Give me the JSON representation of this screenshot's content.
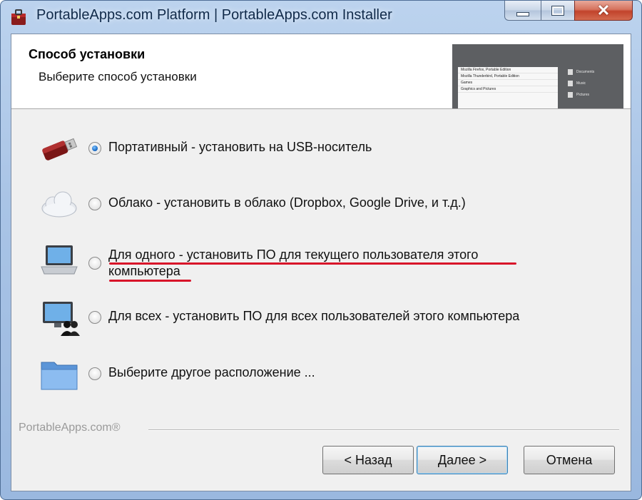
{
  "window": {
    "title": "PortableApps.com Platform | PortableApps.com Installer",
    "controls": {
      "minimize_icon": "minimize-icon",
      "maximize_icon": "maximize-icon",
      "close_icon": "close-icon"
    }
  },
  "header": {
    "title": "Способ установки",
    "subtitle": "Выберите способ установки",
    "preview": {
      "menu_items": [
        "Mozilla Firefox, Portable Edition",
        "Mozilla Thunderbird, Portable Edition",
        "Games",
        "Graphics and Pictures"
      ],
      "side_items": [
        "Documents",
        "Music",
        "Pictures"
      ]
    }
  },
  "options": [
    {
      "icon": "usb-drive-icon",
      "label": "Портативный - установить на USB-носитель",
      "checked": true
    },
    {
      "icon": "cloud-icon",
      "label": "Облако - установить в облако (Dropbox, Google Drive, и т.д.)",
      "checked": false
    },
    {
      "icon": "laptop-icon",
      "label_line1": "Для одного - установить ПО для текущего пользователя этого",
      "label_line2": "компьютера",
      "checked": false,
      "highlighted": true
    },
    {
      "icon": "computer-users-icon",
      "label": "Для всех - установить ПО для всех пользователей этого компьютера",
      "checked": false
    },
    {
      "icon": "folder-icon",
      "label": "Выберите другое расположение ...",
      "checked": false
    }
  ],
  "footer": {
    "brand": "PortableApps.com®"
  },
  "buttons": {
    "back": "< Назад",
    "next": "Далее >",
    "cancel": "Отмена"
  },
  "colors": {
    "accent_radio": "#1f6fc8",
    "highlight_underline": "#d8142a",
    "window_frame": "#a9c4e6",
    "close_button": "#c2432b"
  }
}
